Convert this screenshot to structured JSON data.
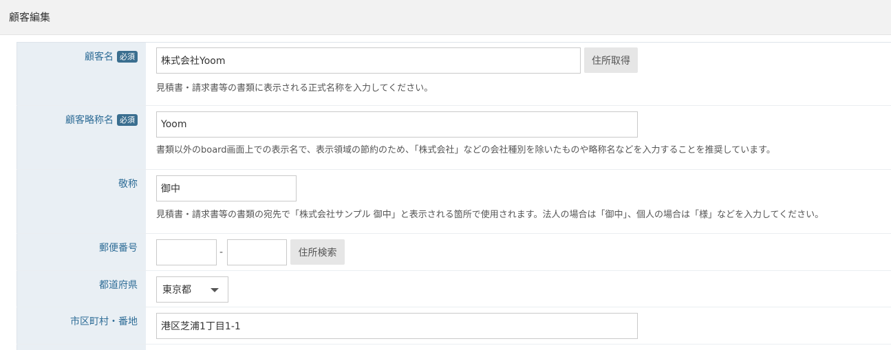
{
  "header": {
    "title": "顧客編集"
  },
  "required_badge": "必須",
  "fields": {
    "name": {
      "label": "顧客名",
      "value": "株式会社Yoom",
      "button": "住所取得",
      "help": "見積書・請求書等の書類に表示される正式名称を入力してください。"
    },
    "short_name": {
      "label": "顧客略称名",
      "value": "Yoom",
      "help": "書類以外のboard画面上での表示名で、表示領域の節約のため、「株式会社」などの会社種別を除いたものや略称名などを入力することを推奨しています。"
    },
    "honorific": {
      "label": "敬称",
      "value": "御中",
      "help": "見積書・請求書等の書類の宛先で「株式会社サンプル 御中」と表示される箇所で使用されます。法人の場合は「御中」、個人の場合は「様」などを入力してください。"
    },
    "postal": {
      "label": "郵便番号",
      "value1": "",
      "value2": "",
      "separator": "-",
      "button": "住所検索"
    },
    "prefecture": {
      "label": "都道府県",
      "selected": "東京都"
    },
    "address": {
      "label": "市区町村・番地",
      "value": "港区芝浦1丁目1-1"
    }
  }
}
